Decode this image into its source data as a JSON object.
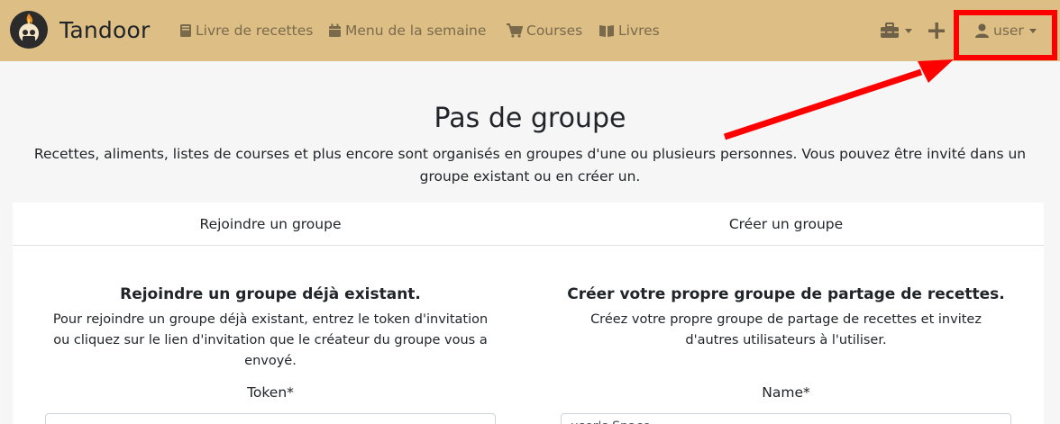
{
  "brand": {
    "name": "Tandoor"
  },
  "nav": {
    "items": [
      {
        "label": "Livre de recettes",
        "icon": "book-icon"
      },
      {
        "label": "Menu de la semaine",
        "icon": "calendar-icon"
      },
      {
        "label": "Courses",
        "icon": "cart-icon"
      },
      {
        "label": "Livres",
        "icon": "open-book-icon"
      }
    ],
    "toolbox_icon": "toolbox-icon",
    "add_icon": "plus-icon",
    "user_label": "user"
  },
  "annotation": {
    "color": "#ff0000"
  },
  "main": {
    "title": "Pas de groupe",
    "description": "Recettes, aliments, listes de courses et plus encore sont organisés en groupes d'une ou plusieurs personnes. Vous pouvez être invité dans un groupe existant ou en créer un.",
    "tabs": [
      {
        "label": "Rejoindre un groupe"
      },
      {
        "label": "Créer un groupe"
      }
    ],
    "join": {
      "heading": "Rejoindre un groupe déjà existant.",
      "description": "Pour rejoindre un groupe déjà existant, entrez le token d'invitation ou cliquez sur le lien d'invitation que le créateur du groupe vous a envoyé.",
      "field_label": "Token*",
      "field_value": ""
    },
    "create": {
      "heading": "Créer votre propre groupe de partage de recettes.",
      "description": "Créez votre propre groupe de partage de recettes et invitez d'autres utilisateurs à l'utiliser.",
      "field_label": "Name*",
      "field_value": "user's Space"
    }
  },
  "colors": {
    "navbar": "#ddbf86",
    "background": "#f6f6f6"
  }
}
